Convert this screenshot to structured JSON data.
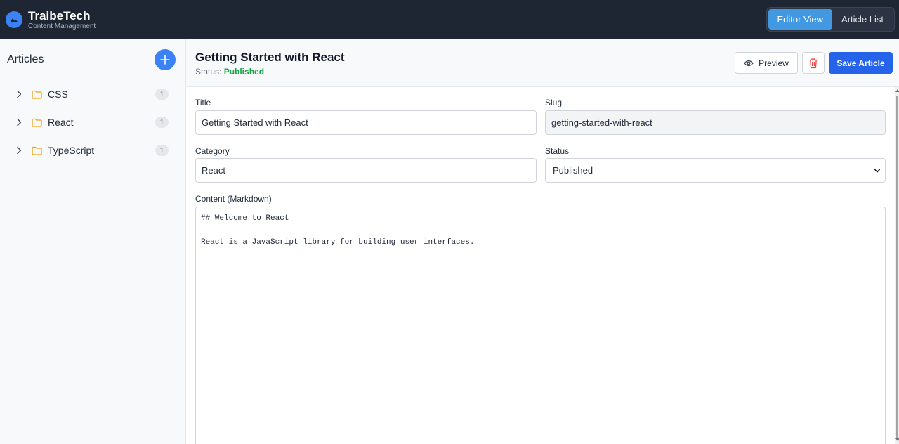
{
  "app": {
    "name": "TraibeTech",
    "subtitle": "Content Management",
    "views": [
      {
        "label": "Editor View",
        "active": true
      },
      {
        "label": "Article List",
        "active": false
      }
    ]
  },
  "sidebar": {
    "title": "Articles",
    "folders": [
      {
        "label": "CSS",
        "count": "1"
      },
      {
        "label": "React",
        "count": "1"
      },
      {
        "label": "TypeScript",
        "count": "1"
      }
    ]
  },
  "editor": {
    "title": "Getting Started with React",
    "status_prefix": "Status: ",
    "status_value": "Published",
    "preview_label": "Preview",
    "save_label": "Save Article",
    "fields": {
      "title_label": "Title",
      "title_value": "Getting Started with React",
      "slug_label": "Slug",
      "slug_value": "getting-started-with-react",
      "category_label": "Category",
      "category_value": "React",
      "status_label": "Status",
      "status_value": "Published",
      "content_label": "Content (Markdown)",
      "content_value": "## Welcome to React\n\nReact is a JavaScript library for building user interfaces."
    }
  },
  "colors": {
    "topbar": "#1e2533",
    "accent": "#3b82f6",
    "save_button": "#2563eb",
    "active_view": "#4299e1",
    "status_published": "#16a34a",
    "delete_icon": "#ef4444",
    "folder_icon": "#f59e0b"
  },
  "icons": {
    "logo": "mountain-logo-icon",
    "add": "plus-icon",
    "expand": "chevron-right-icon",
    "folder": "folder-icon",
    "preview": "eye-icon",
    "delete": "trash-icon",
    "select": "chevron-down-icon"
  }
}
